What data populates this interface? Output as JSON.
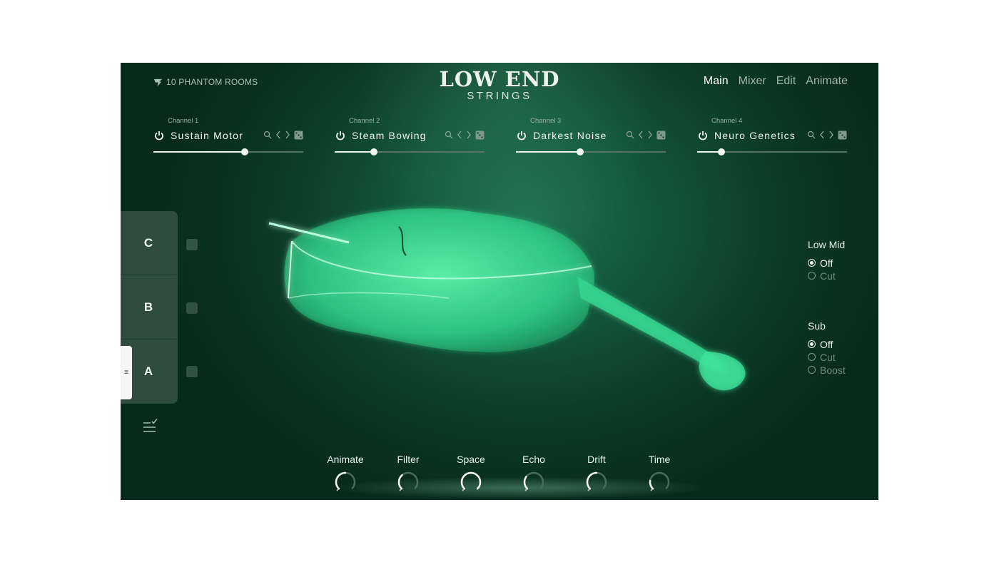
{
  "header": {
    "brand": "10 PHANTOM ROOMS",
    "logo_title": "LOW END",
    "logo_subtitle": "STRINGS"
  },
  "nav": {
    "tabs": [
      {
        "label": "Main",
        "active": true
      },
      {
        "label": "Mixer",
        "active": false
      },
      {
        "label": "Edit",
        "active": false
      },
      {
        "label": "Animate",
        "active": false
      }
    ]
  },
  "channels": [
    {
      "number_label": "Channel 1",
      "name": "Sustain Motor",
      "level": 0.61
    },
    {
      "number_label": "Channel 2",
      "name": "Steam Bowing",
      "level": 0.26
    },
    {
      "number_label": "Channel 3",
      "name": "Darkest Noise",
      "level": 0.43
    },
    {
      "number_label": "Channel 4",
      "name": "Neuro Genetics",
      "level": 0.16
    }
  ],
  "scenes": {
    "items": [
      "C",
      "B",
      "A"
    ],
    "active": "A"
  },
  "eq": {
    "low_mid": {
      "title": "Low Mid",
      "options": [
        "Off",
        "Cut"
      ],
      "selected": "Off"
    },
    "sub": {
      "title": "Sub",
      "options": [
        "Off",
        "Cut",
        "Boost"
      ],
      "selected": "Off"
    }
  },
  "knobs": [
    {
      "label": "Animate",
      "value": 0.5
    },
    {
      "label": "Filter",
      "value": 0.35
    },
    {
      "label": "Space",
      "value": 1.0
    },
    {
      "label": "Echo",
      "value": 0.3
    },
    {
      "label": "Drift",
      "value": 0.5
    },
    {
      "label": "Time",
      "value": 0.2
    }
  ],
  "colors": {
    "background": "#0f4a33",
    "accent": "#3fe39a",
    "text": "#eef5f1",
    "muted": "#9fb6aa"
  }
}
